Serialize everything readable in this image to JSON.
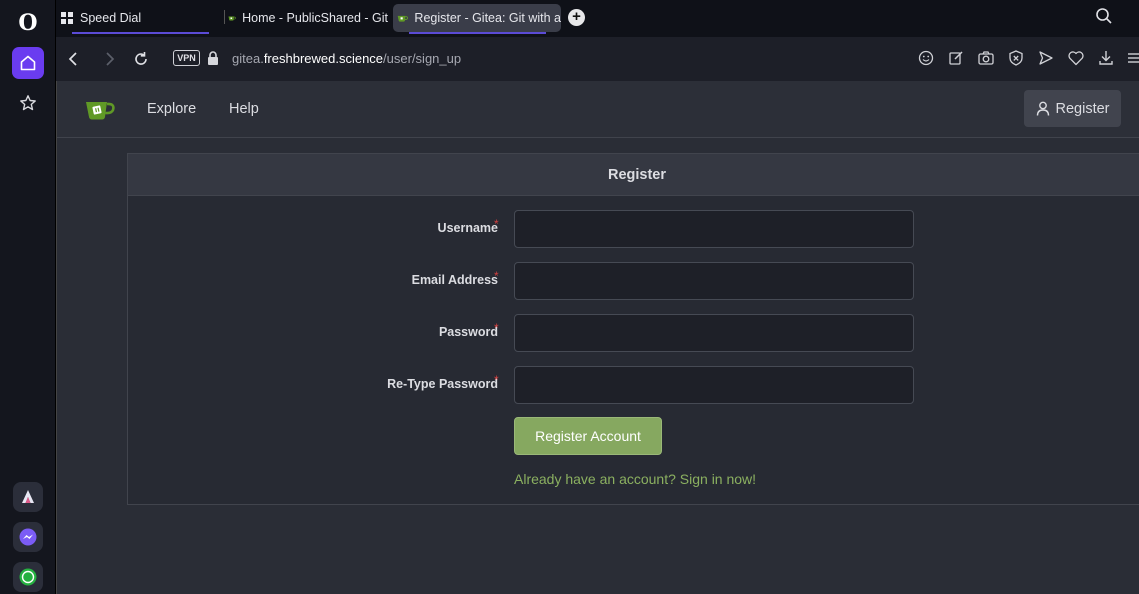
{
  "browser": {
    "logo": "O",
    "tabs": [
      {
        "label": "Speed Dial",
        "icon": "speed-dial-icon"
      },
      {
        "label": "Home - PublicShared - Git",
        "icon": "gitea-icon"
      },
      {
        "label": "Register - Gitea: Git with a",
        "icon": "gitea-icon",
        "active": true
      }
    ],
    "new_tab": "+",
    "vpn_label": "VPN",
    "url": {
      "prefix": "gitea.",
      "host": "freshbrewed.science",
      "path": "/user/sign_up"
    }
  },
  "sidebar": {
    "items": [
      "home-icon",
      "star-icon",
      "aria-icon",
      "messenger-icon",
      "whatsapp-icon"
    ]
  },
  "gitea": {
    "nav": {
      "explore": "Explore",
      "help": "Help",
      "register": "Register"
    },
    "form": {
      "title": "Register",
      "fields": [
        {
          "label": "Username",
          "required": "*",
          "value": ""
        },
        {
          "label": "Email Address",
          "required": "*",
          "value": ""
        },
        {
          "label": "Password",
          "required": "*",
          "value": ""
        },
        {
          "label": "Re-Type Password",
          "required": "*",
          "value": ""
        }
      ],
      "submit": "Register Account",
      "signin_link": "Already have an account? Sign in now!"
    }
  },
  "colors": {
    "accent": "#6a3cf0",
    "gitea_green": "#86a860",
    "link_green": "#8bb060",
    "required_red": "#d04040"
  }
}
